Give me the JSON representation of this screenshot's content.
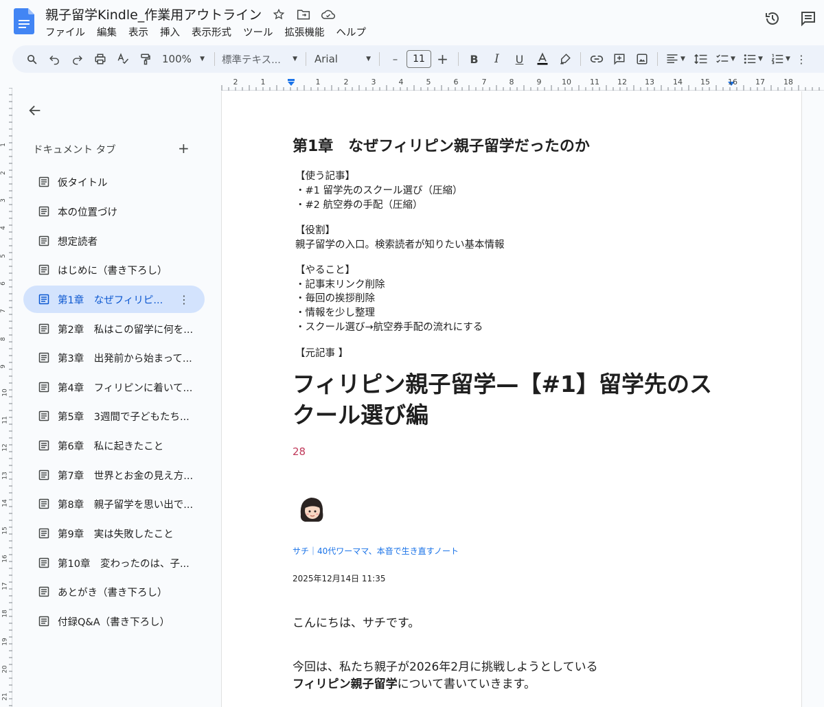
{
  "doc": {
    "title": "親子留学Kindle_作業用アウトライン"
  },
  "menu": [
    "ファイル",
    "編集",
    "表示",
    "挿入",
    "表示形式",
    "ツール",
    "拡張機能",
    "ヘルプ"
  ],
  "toolbar": {
    "zoom": "100%",
    "style": "標準テキス...",
    "font": "Arial",
    "font_size": "11",
    "minus": "–",
    "plus": "+"
  },
  "ruler_top": [
    "2",
    "1",
    "1",
    "2",
    "3",
    "4",
    "5",
    "6",
    "7",
    "8",
    "9",
    "10",
    "11",
    "12",
    "13",
    "14",
    "15",
    "16",
    "17",
    "18"
  ],
  "ruler_left": [
    "1",
    "2",
    "3",
    "4",
    "5",
    "6",
    "7",
    "8",
    "9",
    "10",
    "11",
    "12",
    "13",
    "14",
    "15",
    "16",
    "17",
    "18",
    "19",
    "20",
    "21"
  ],
  "sidebar": {
    "header": "ドキュメント タブ",
    "add": "+",
    "active_index": 4,
    "tabs": [
      "仮タイトル",
      "本の位置づけ",
      "想定読者",
      "はじめに（書き下ろし）",
      "第1章　なぜフィリピ...",
      "第2章　私はこの留学に何を...",
      "第3章　出発前から始まって...",
      "第4章　フィリピンに着いて...",
      "第5章　3週間で子どもたち...",
      "第6章　私に起きたこと",
      "第7章　世界とお金の見え方...",
      "第8章　親子留学を思い出で...",
      "第9章　実は失敗したこと",
      "第10章　変わったのは、子...",
      "あとがき（書き下ろし）",
      "付録Q&A（書き下ろし）"
    ]
  },
  "page": {
    "heading": "第1章　なぜフィリピン親子留学だったのか",
    "lines": [
      "【使う記事】",
      "・#1 留学先のスクール選び（圧縮）",
      "・#2 航空券の手配（圧縮）",
      "【役割】",
      "親子留学の入口。検索読者が知りたい基本情報",
      "【やること】",
      "・記事末リンク削除",
      "・毎回の挨拶削除",
      "・情報を少し整理",
      "・スクール選び→航空券手配の流れにする",
      "【元記事 】"
    ],
    "article_title": "フィリピン親子留学—【#1】留学先のスクール選び編",
    "likes": "28",
    "author": "サチ｜40代ワーママ、本音で生き直すノート",
    "date": "2025年12月14日 11:35",
    "greeting": "こんにちは、サチです。",
    "para_line1": "今回は、私たち親子が2026年2月に挑戦しようとしている",
    "para_bold": "フィリピン親子留学",
    "para_line2_rest": "について書いていきます。"
  }
}
